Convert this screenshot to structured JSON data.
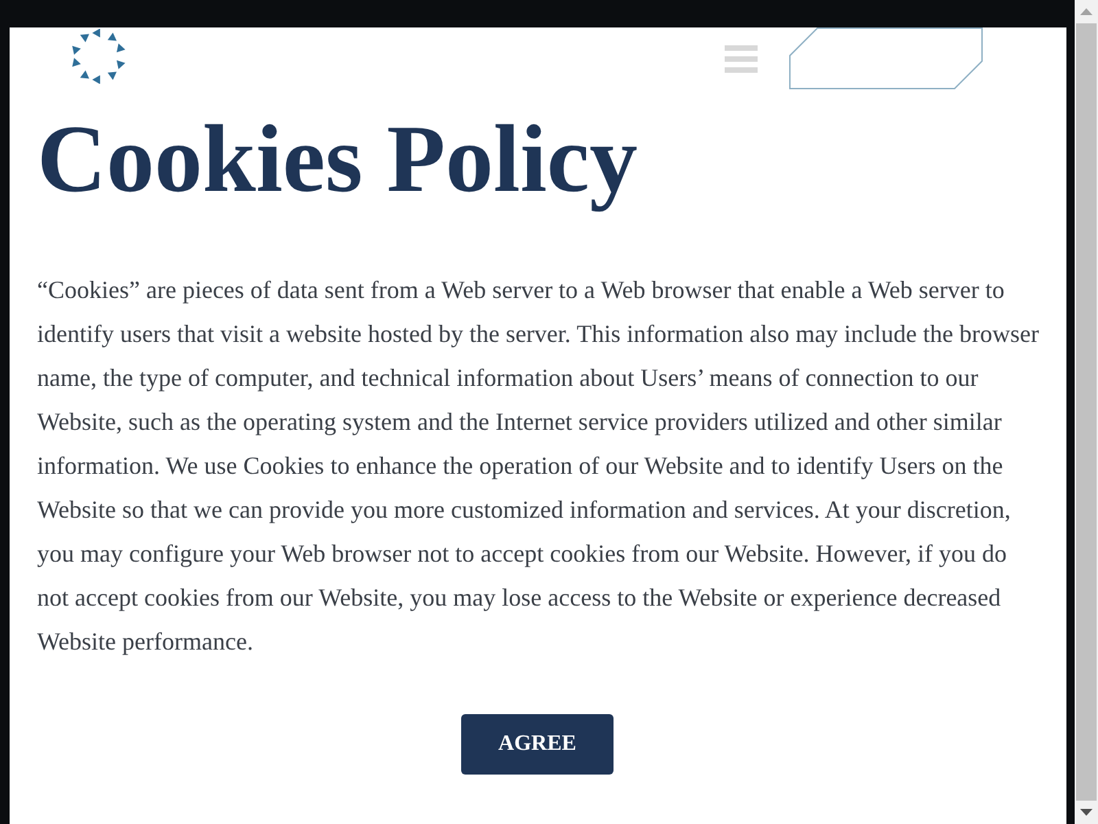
{
  "title": "Cookies Policy",
  "body": "“Cookies” are pieces of data sent from a Web server to a Web browser that enable a Web server to identify users that visit a website hosted by the server. This information also may include the browser name, the type of computer, and technical information about Users’ means of connection to our Website, such as the operating system and the Internet service providers utilized and other similar information. We use Cookies to enhance the operation of our Website and to identify Users on the Website so that we can provide you more customized information and services. At your discretion, you may configure your Web browser not to accept cookies from our Website. However, if you do not accept cookies from our Website, you may lose access to the Website or experience decreased Website performance.",
  "agree_button": {
    "label": "AGREE"
  }
}
